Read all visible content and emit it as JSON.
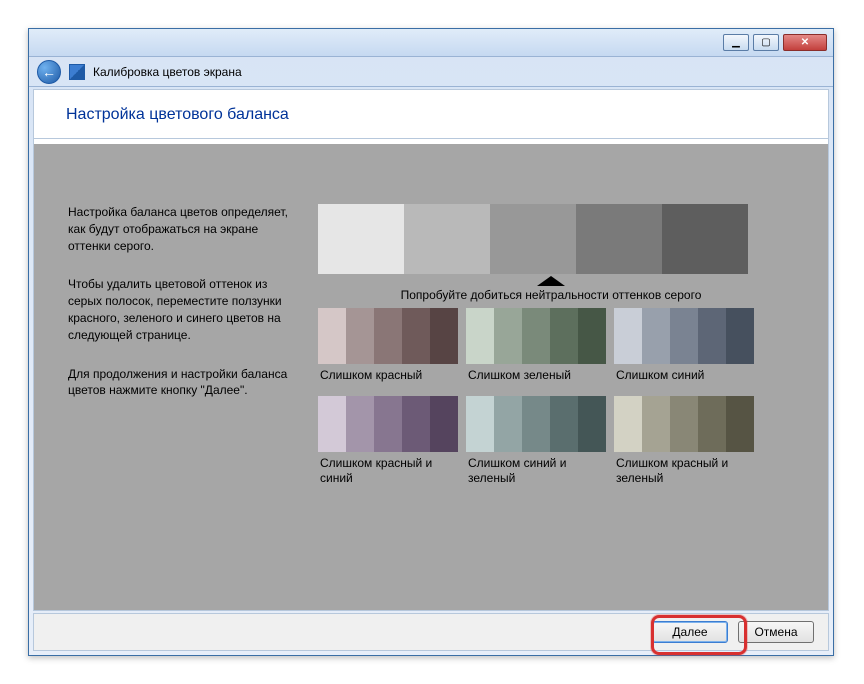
{
  "window": {
    "title": "Калибровка цветов экрана"
  },
  "page": {
    "heading": "Настройка цветового баланса"
  },
  "instructions": {
    "p1": "Настройка баланса цветов определяет, как будут отображаться на экране оттенки серого.",
    "p2": "Чтобы удалить цветовой оттенок из серых полосок, переместите ползунки красного, зеленого и синего цветов на следующей странице.",
    "p3": "Для продолжения и настройки баланса цветов нажмите кнопку \"Далее\"."
  },
  "neutral": {
    "caption": "Попробуйте добиться нейтральности оттенков серого",
    "swatches": [
      "#e6e6e6",
      "#b9b9b9",
      "#989898",
      "#7a7a7a",
      "#5e5e5e"
    ]
  },
  "examples": [
    {
      "label": "Слишком красный",
      "colors": [
        "#d5c7c7",
        "#a59595",
        "#8a7676",
        "#6f5a5a",
        "#574444"
      ]
    },
    {
      "label": "Слишком зеленый",
      "colors": [
        "#c9d5c9",
        "#98a698",
        "#7a8a7a",
        "#5d6f5d",
        "#465746"
      ]
    },
    {
      "label": "Слишком синий",
      "colors": [
        "#c9ced7",
        "#98a0ac",
        "#7a8392",
        "#5d6676",
        "#46505e"
      ]
    },
    {
      "label": "Слишком красный и синий",
      "colors": [
        "#d3c9d7",
        "#a395aa",
        "#877690",
        "#6c5a76",
        "#55445e"
      ]
    },
    {
      "label": "Слишком синий и зеленый",
      "colors": [
        "#c4d3d3",
        "#93a5a5",
        "#768989",
        "#5a6e6e",
        "#445656"
      ]
    },
    {
      "label": "Слишком красный и зеленый",
      "colors": [
        "#d3d2c4",
        "#a5a393",
        "#898776",
        "#6e6c5a",
        "#565444"
      ]
    }
  ],
  "buttons": {
    "next": "Далее",
    "cancel": "Отмена"
  }
}
